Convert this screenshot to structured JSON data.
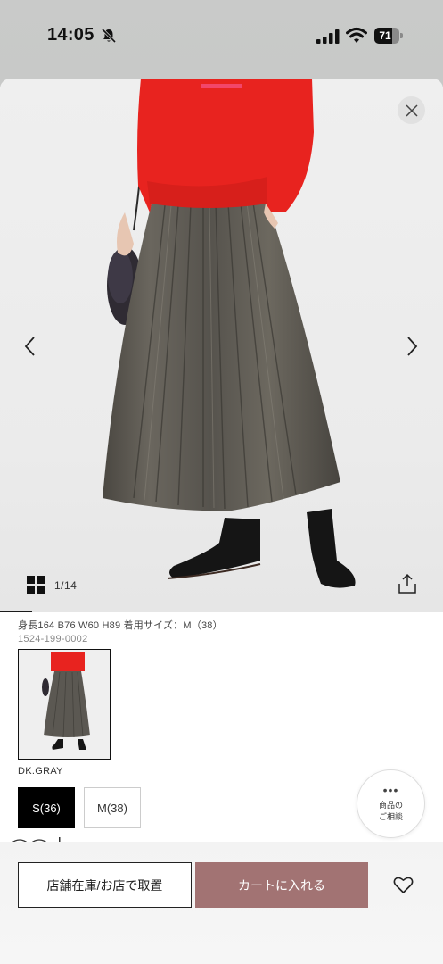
{
  "status_bar": {
    "time": "14:05",
    "battery": 71,
    "battery_label": "71"
  },
  "gallery": {
    "counter": "1/14",
    "current_index": 1,
    "total_images": 14
  },
  "product": {
    "model_info": "身長164 B76 W60 H89 着用サイズ：M（38）",
    "product_code": "1524-199-0002",
    "color_name": "DK.GRAY",
    "sizes": [
      {
        "label": "S(36)",
        "selected": true
      },
      {
        "label": "M(38)",
        "selected": false
      }
    ]
  },
  "consult": {
    "dots": "•••",
    "label": "商品の\nご相談"
  },
  "actions": {
    "store_label": "店舗在庫/お店で取置",
    "cart_label": "カートに入れる"
  },
  "colors": {
    "accent": "#a27373",
    "selected_size_bg": "#000000",
    "sweater_red": "#e8231f",
    "skirt_gray": "#5b5852"
  },
  "icons": [
    "bell-slash-icon",
    "signal-icon",
    "wifi-icon",
    "battery-icon",
    "close-icon",
    "chevron-left-icon",
    "chevron-right-icon",
    "grid-icon",
    "share-icon",
    "heart-icon"
  ]
}
